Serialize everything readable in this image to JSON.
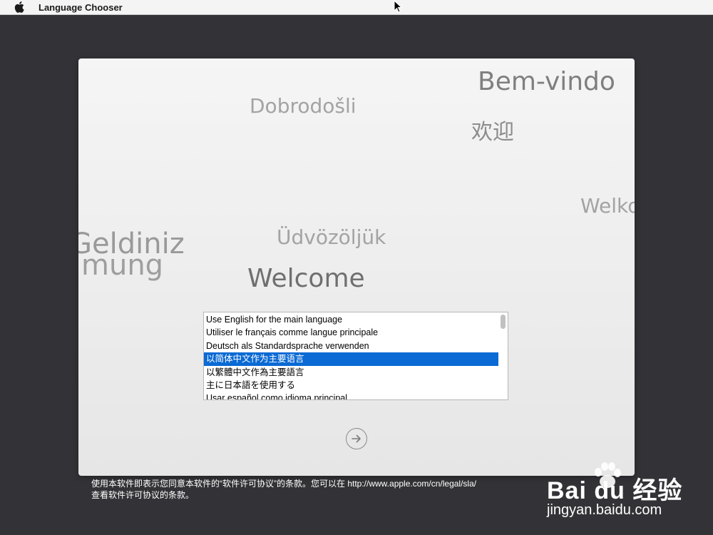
{
  "menubar": {
    "apple_icon": "apple-logo-icon",
    "app_title": "Language Chooser"
  },
  "greetings": {
    "bem_vindo": "Bem-vindo",
    "dobrodosli": "Dobrodošli",
    "huanying": "欢迎",
    "welko": "Welko",
    "udvozoljuk": "Üdvözöljük",
    "geldiniz": "Geldiniz",
    "mung": "mung",
    "welcome": "Welcome"
  },
  "language_list": {
    "items": [
      "Use English for the main language",
      "Utiliser le français comme langue principale",
      "Deutsch als Standardsprache verwenden",
      "以简体中文作为主要语言",
      "以繁體中文作為主要語言",
      "主に日本語を使用する",
      "Usar español como idioma principal"
    ],
    "selected_index": 3
  },
  "continue_button": {
    "icon": "arrow-right-icon"
  },
  "legal": {
    "line1": "使用本软件即表示您同意本软件的“软件许可协议”的条款。您可以在 http://www.apple.com/cn/legal/sla/",
    "line2": "查看软件许可协议的条款。"
  },
  "watermark": {
    "brand": "Bai du 经验",
    "url": "jingyan.baidu.com"
  },
  "colors": {
    "background": "#333337",
    "selection": "#0b6ad4",
    "menubar": "#f4f4f4"
  }
}
